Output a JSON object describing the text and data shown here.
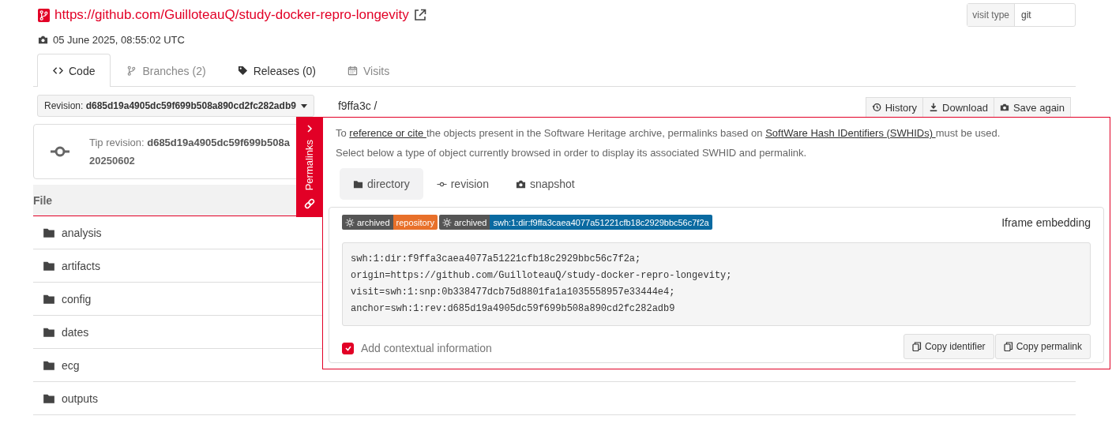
{
  "origin": {
    "url": "https://github.com/GuilloteauQ/study-docker-repro-longevity"
  },
  "visit_type": {
    "label": "visit type",
    "value": "git"
  },
  "snapshot_date": "05 June 2025, 08:55:02 UTC",
  "tabs": [
    {
      "label": "Code",
      "selected": true,
      "dimmed": false
    },
    {
      "label": "Branches (2)",
      "selected": false,
      "dimmed": true
    },
    {
      "label": "Releases (0)",
      "selected": false,
      "dimmed": false
    },
    {
      "label": "Visits",
      "selected": false,
      "dimmed": true
    }
  ],
  "revision": {
    "label": "Revision:",
    "value": "d685d19a4905dc59f699b508a890cd2fc282adb9"
  },
  "path": "f9ffa3c /",
  "actions": [
    {
      "label": "History"
    },
    {
      "label": "Download"
    },
    {
      "label": "Save again"
    }
  ],
  "tip_revision": {
    "label": "Tip revision:",
    "value": "d685d19a4905dc59f699b508a",
    "date": "20250602"
  },
  "files": {
    "header": "File",
    "rows": [
      {
        "name": "analysis"
      },
      {
        "name": "artifacts"
      },
      {
        "name": "config"
      },
      {
        "name": "dates"
      },
      {
        "name": "ecg"
      },
      {
        "name": "outputs"
      }
    ]
  },
  "permalinks": {
    "tab_label": "Permalinks",
    "intro": [
      {
        "kind": "text",
        "text": "To "
      },
      {
        "kind": "link",
        "text": "reference or cite "
      },
      {
        "kind": "text",
        "text": "the objects present in the Software Heritage archive, permalinks based on "
      },
      {
        "kind": "link",
        "text": "SoftWare Hash IDentifiers (SWHIDs) "
      },
      {
        "kind": "text",
        "text": "must be used."
      }
    ],
    "hint": "Select below a type of object currently browsed in order to display its associated SWHID and permalink.",
    "object_types": [
      {
        "label": "directory",
        "selected": true
      },
      {
        "label": "revision",
        "selected": false
      },
      {
        "label": "snapshot",
        "selected": false
      }
    ],
    "badges": [
      {
        "left": "archived",
        "right": "repository",
        "color": "#e8702a"
      },
      {
        "left": "archived",
        "right": "swh:1:dir:f9ffa3caea4077a51221cfb18c2929bbc56c7f2a",
        "color": "#0a6aa1"
      }
    ],
    "iframe_label": "Iframe embedding",
    "swhid_lines": [
      "swh:1:dir:f9ffa3caea4077a51221cfb18c2929bbc56c7f2a;",
      "origin=https://github.com/GuilloteauQ/study-docker-repro-longevity;",
      "visit=swh:1:snp:0b338477dcb75d8801fa1a1035558957e33444e4;",
      "anchor=swh:1:rev:d685d19a4905dc59f699b508a890cd2fc282adb9"
    ],
    "contextual": {
      "label": "Add contextual information",
      "checked": true
    },
    "buttons": [
      "Copy identifier",
      "Copy permalink"
    ]
  }
}
